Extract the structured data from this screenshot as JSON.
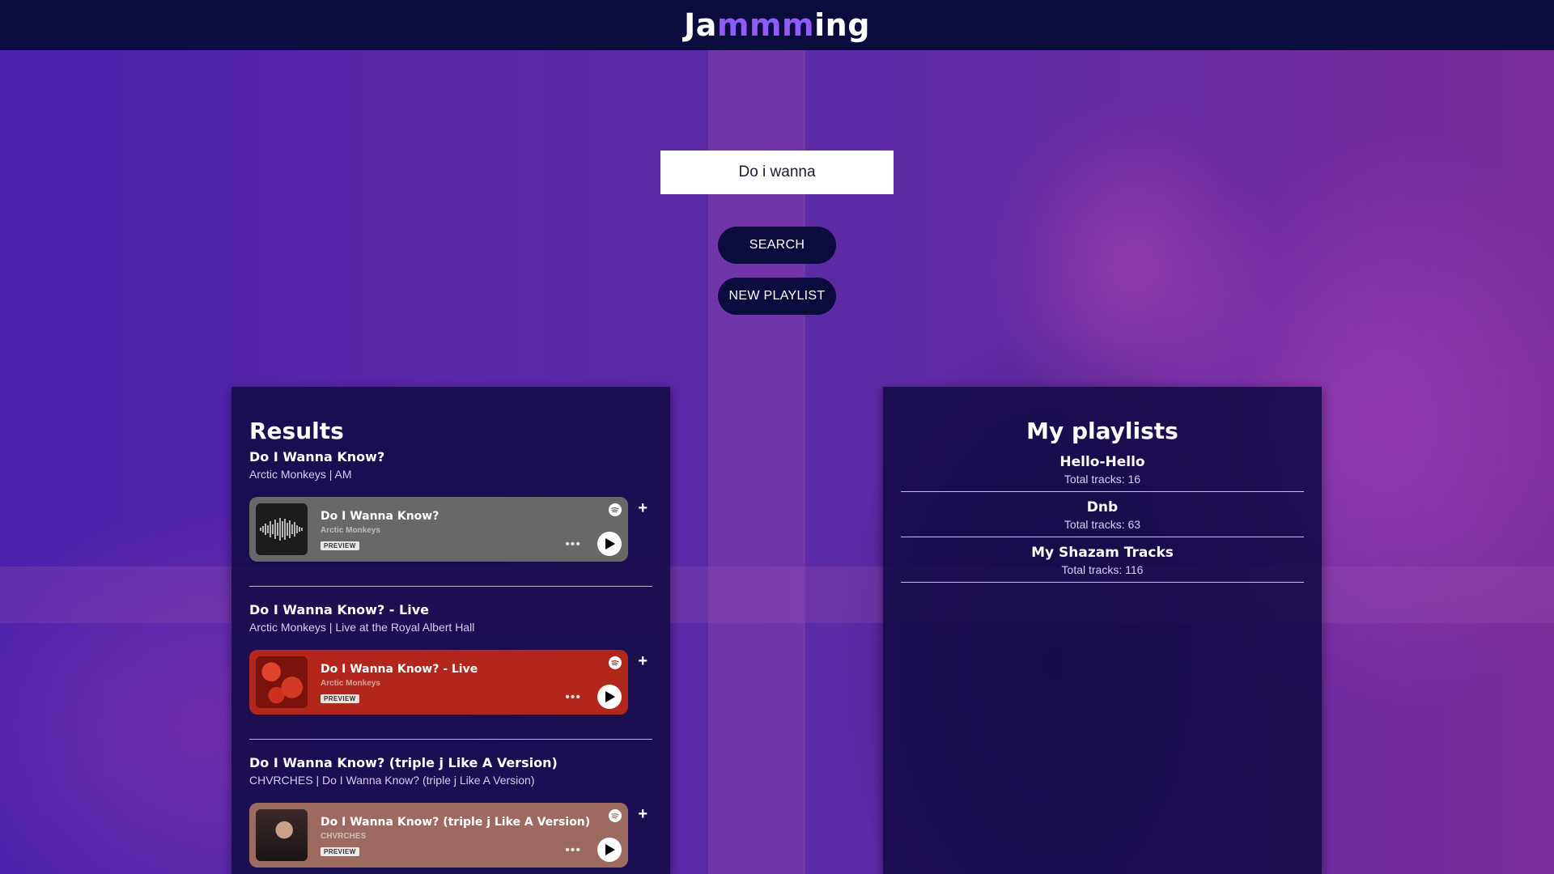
{
  "app": {
    "logo_prefix": "Ja",
    "logo_highlight": "mmm",
    "logo_suffix": "ing",
    "accent": "#8e5cf7"
  },
  "search": {
    "value": "Do i wanna",
    "button_label": "SEARCH",
    "new_playlist_label": "NEW PLAYLIST"
  },
  "results": {
    "title": "Results",
    "tracks": [
      {
        "name": "Do I Wanna Know?",
        "meta": "Arctic Monkeys | AM",
        "embed_title": "Do I Wanna Know?",
        "embed_artist": "Arctic Monkeys",
        "badge": "PREVIEW",
        "embed_color": "#686868",
        "add_label": "+"
      },
      {
        "name": "Do I Wanna Know? - Live",
        "meta": "Arctic Monkeys | Live at the Royal Albert Hall",
        "embed_title": "Do I Wanna Know? - Live",
        "embed_artist": "Arctic Monkeys",
        "badge": "PREVIEW",
        "embed_color": "#b2261c",
        "add_label": "+"
      },
      {
        "name": "Do I Wanna Know? (triple j Like A Version)",
        "meta": "CHVRCHES | Do I Wanna Know? (triple j Like A Version)",
        "embed_title": "Do I Wanna Know? (triple j Like A Version)",
        "embed_artist": "CHVRCHES",
        "badge": "PREVIEW",
        "embed_color": "#9c6a5e",
        "add_label": "+"
      }
    ]
  },
  "playlists": {
    "title": "My playlists",
    "items": [
      {
        "name": "Hello-Hello",
        "count": "Total tracks: 16"
      },
      {
        "name": "Dnb",
        "count": "Total tracks: 63"
      },
      {
        "name": "My Shazam Tracks",
        "count": "Total tracks: 116"
      }
    ]
  },
  "icons": {
    "spotify": "spotify-icon",
    "play": "play-icon",
    "more": "more-options-icon",
    "add": "add-icon"
  }
}
